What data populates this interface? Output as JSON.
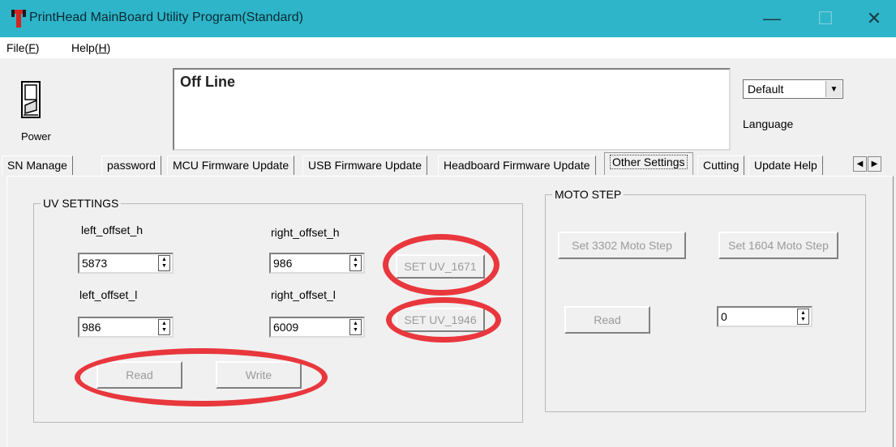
{
  "window": {
    "title": "PrintHead MainBoard Utility Program(Standard)",
    "min_glyph": "—",
    "max_glyph": "☐",
    "close_glyph": "✕"
  },
  "menu": {
    "file": {
      "label": "File(",
      "key": "F",
      "end": ")"
    },
    "help": {
      "label": "Help(",
      "key": "H",
      "end": ")"
    }
  },
  "power": {
    "label": "Power",
    "icon": "power-switch-icon"
  },
  "status": {
    "text": "Off Line"
  },
  "language": {
    "selected": "Default",
    "label": "Language"
  },
  "tabs": [
    {
      "label": "SN Manage"
    },
    {
      "label": "password"
    },
    {
      "label": "MCU Firmware Update"
    },
    {
      "label": "USB Firmware Update"
    },
    {
      "label": "Headboard Firmware Update"
    },
    {
      "label": "Other Settings"
    },
    {
      "label": "Cutting"
    },
    {
      "label": "Update Help"
    }
  ],
  "uv_settings": {
    "title": "UV SETTINGS",
    "left_offset_h": {
      "label": "left_offset_h",
      "value": "5873"
    },
    "right_offset_h": {
      "label": "right_offset_h",
      "value": "986"
    },
    "left_offset_l": {
      "label": "left_offset_l",
      "value": "986"
    },
    "right_offset_l": {
      "label": "right_offset_l",
      "value": "6009"
    },
    "set_uv_1671": "SET UV_1671",
    "set_uv_1946": "SET UV_1946",
    "read": "Read",
    "write": "Write"
  },
  "moto_step": {
    "title": "MOTO STEP",
    "set_3302": "Set 3302 Moto Step",
    "set_1604": "Set 1604 Moto Step",
    "read": "Read",
    "step_value": "0"
  },
  "colors": {
    "titlebar": "#2eb5c9",
    "highlight_circle": "#e8373d",
    "disabled_text": "#9a9a9a"
  }
}
